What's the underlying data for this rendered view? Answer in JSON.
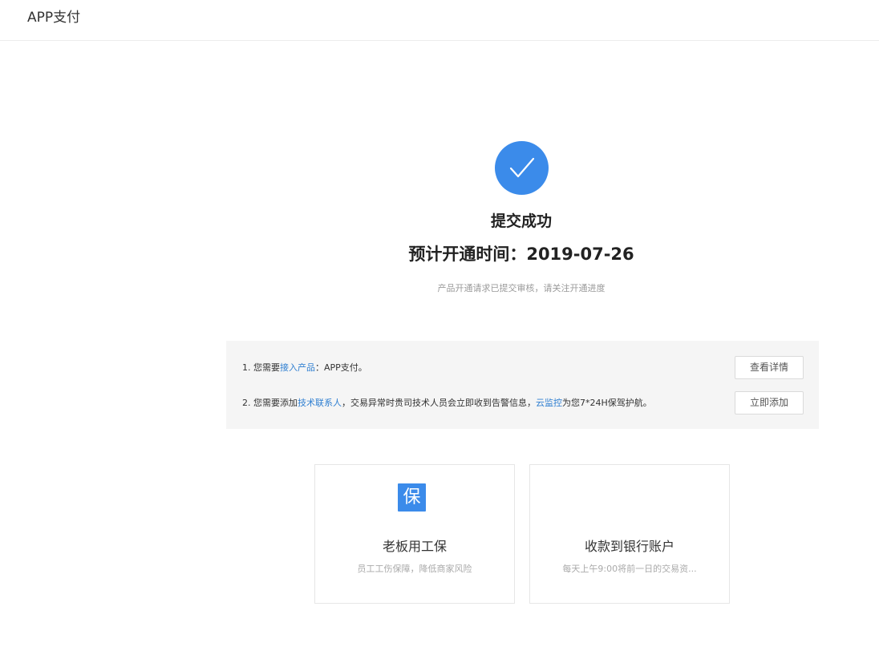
{
  "header": {
    "title": "APP支付"
  },
  "status": {
    "icon": "check-circle-icon",
    "accent_color": "#3b8bea",
    "title": "提交成功",
    "date_line": "预计开通时间：2019-07-26",
    "subtitle": "产品开通请求已提交审核，请关注开通进度"
  },
  "todo": {
    "item1": {
      "prefix": "1. 您需要",
      "link": "接入产品",
      "suffix": "：APP支付。",
      "button": "查看详情"
    },
    "item2": {
      "prefix": "2. 您需要添加",
      "link1": "技术联系人",
      "middle": "，交易异常时贵司技术人员会立即收到告警信息，",
      "link2": "云监控",
      "suffix": "为您7*24H保驾护航。",
      "button": "立即添加"
    }
  },
  "cards": [
    {
      "icon": "bao-icon",
      "icon_glyph": "保",
      "title": "老板用工保",
      "desc": "员工工伤保障，降低商家风险"
    },
    {
      "title": "收款到银行账户",
      "desc": "每天上午9:00将前一日的交易资..."
    }
  ]
}
